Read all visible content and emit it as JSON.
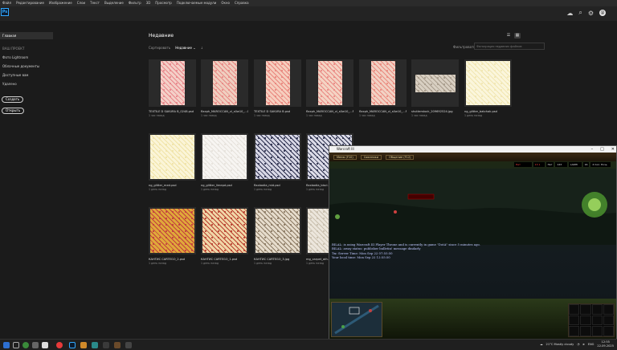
{
  "menu": [
    "Файл",
    "Редактирование",
    "Изображение",
    "Слои",
    "Текст",
    "Выделение",
    "Фильтр",
    "3D",
    "Просмотр",
    "Подключаемые модули",
    "Окно",
    "Справка"
  ],
  "app": {
    "logo": "Ps"
  },
  "header_icons": [
    "cloud-icon",
    "search-icon",
    "gear-icon"
  ],
  "avatar_initial": "@",
  "sidebar": {
    "home": "Главная",
    "section": "ВАШ ПРОЕКТ",
    "items": [
      "Фото Lightroom",
      "Облачные документы",
      "Доступные вам",
      "Удалено"
    ],
    "create_btn": "Создать",
    "open_btn": "Открыть"
  },
  "main": {
    "title": "Недавние",
    "sort_label": "Сортировать",
    "sort_value": "Недавние",
    "filter_label": "Фильтровать",
    "filter_placeholder": "Фильтрация недавних файлов"
  },
  "tiles": [
    {
      "name": "TEXTILE D SAKURA B_0248.psd",
      "date": "1 час назад",
      "c1": "#e8868a",
      "c2": "#f4d0c8"
    },
    {
      "name": "flaxph_MAROCCAN_vl_s0w10_...GUE_dl.psd",
      "date": "1 час назад",
      "c1": "#e88a86",
      "c2": "#f0cfc0"
    },
    {
      "name": "TEXTILE D SAKURA B.psd",
      "date": "1 час назад",
      "c1": "#e9857d",
      "c2": "#f6cfbf"
    },
    {
      "name": "flaxph_MAROCCAN_vl_s0w10_...PRINT_LIGT.psd",
      "date": "1 час назад",
      "c1": "#ea8a84",
      "c2": "#f4d4c4"
    },
    {
      "name": "flaxph_MAROCCAN_vl_s0w10_...PRINT_dl.psd",
      "date": "1 час назад",
      "c1": "#ea8b80",
      "c2": "#f2d2c4"
    },
    {
      "name": "shutterstock_209692524.jpg",
      "date": "1 час назад",
      "c1": "#a89c8c",
      "c2": "#d8cfc2"
    },
    {
      "name": "ng_glitter_batchak.psd",
      "date": "1 день назад",
      "c1": "#f1e6b2",
      "c2": "#fbf6dc"
    },
    {
      "name": "ng_glitter_med.psd",
      "date": "1 день назад",
      "c1": "#f0e3a8",
      "c2": "#fbf5d8"
    },
    {
      "name": "ng_glitter_limepd.psd",
      "date": "1 день назад",
      "c1": "#e6e2dc",
      "c2": "#f7f5f2"
    },
    {
      "name": "flaxbodia_mid.psd",
      "date": "1 день назад",
      "c1": "#2c2f4e",
      "c2": "#d8d8e6"
    },
    {
      "name": "flaxbodia_biscl...",
      "date": "1 день назад",
      "c1": "#2b2f4c",
      "c2": "#dcdce8"
    },
    {
      "name": "КАНТИС CARTEGO_2.psd",
      "date": "1 день назад",
      "c1": "#c23e3e",
      "c2": "#e0a93a"
    },
    {
      "name": "КАНТИС CARTEGO_1.psd",
      "date": "1 день назад",
      "c1": "#b94030",
      "c2": "#f1d7a8"
    },
    {
      "name": "КАНТИС CARTEGO_3.jpg",
      "date": "1 день назад",
      "c1": "#8c7a63",
      "c2": "#e6dccc"
    },
    {
      "name": "mg_carpet_ath...",
      "date": "1 день назад",
      "c1": "#c9bfae",
      "c2": "#ece6dc"
    }
  ],
  "game_window": {
    "title": "Warcraft III",
    "menu_buttons": [
      "Меню (F10)",
      "Союзники",
      "Общение (F12)"
    ],
    "resources": [
      "Нет ресурсов",
      "13 1 (3)",
      "Нет",
      "143 000",
      "LADHI 37",
      "16",
      "4 Сол. Ночь сон"
    ],
    "respawn": "Respawn in 7 seconds",
    "chat": [
      "BILAL: is using Warcraft III Player Throne and is currently in game \"DotA\" since 5 minutes ago.",
      "BILAL: away status: publisher bulletin! message dindarly",
      "Ты: Server Time: Mon Sep 22 07:55:50",
      "Your local time: Mon Sep 22 12:55:50"
    ]
  },
  "taskbar": {
    "weather": "21°C Mostly cloudy",
    "time": "12:55",
    "date": "22.09.2025",
    "lang": "ENG"
  }
}
